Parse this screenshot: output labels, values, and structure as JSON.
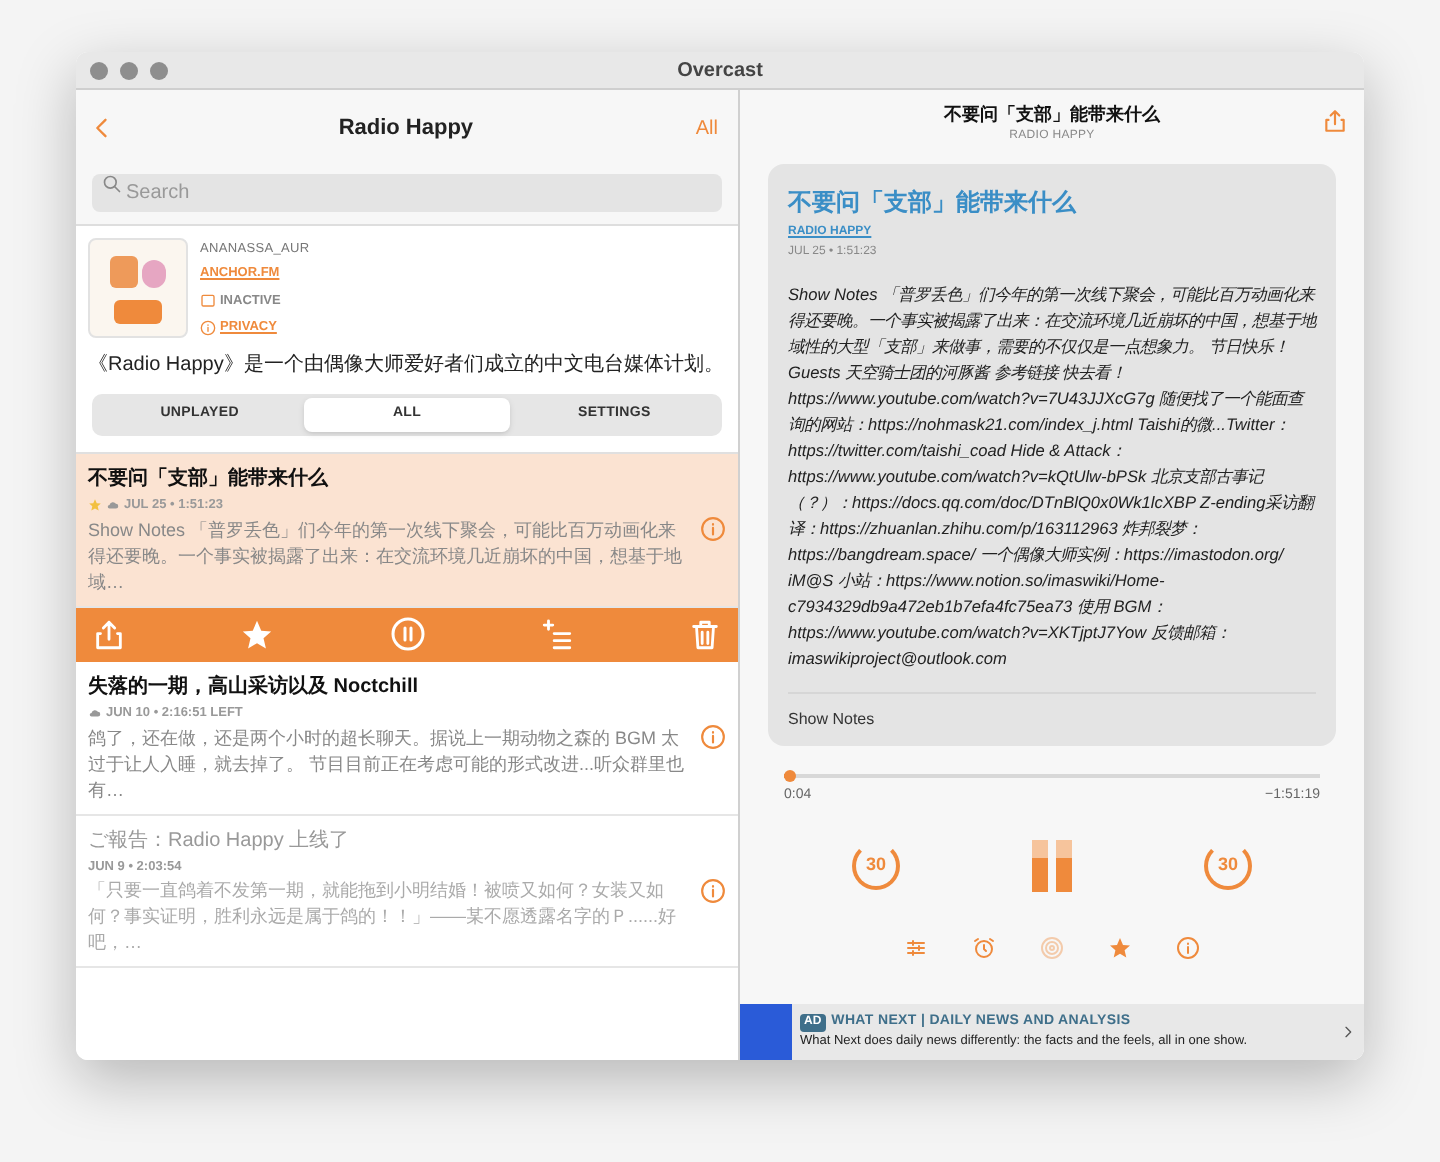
{
  "window": {
    "title": "Overcast"
  },
  "list_header": {
    "title": "Radio Happy",
    "filter": "All"
  },
  "search": {
    "placeholder": "Search"
  },
  "podcast": {
    "author": "ANANASSA_AUR",
    "host": "ANCHOR.FM",
    "status": "INACTIVE",
    "privacy": "PRIVACY",
    "description": "《Radio Happy》是一个由偶像大师爱好者们成立的中文电台媒体计划。"
  },
  "segments": [
    {
      "label": "UNPLAYED",
      "selected": false
    },
    {
      "label": "ALL",
      "selected": true
    },
    {
      "label": "SETTINGS",
      "selected": false
    }
  ],
  "episodes": [
    {
      "title": "不要问「支部」能带来什么",
      "meta": "JUL 25 • 1:51:23",
      "summary": "Show Notes 「普罗丢色」们今年的第一次线下聚会，可能比百万动画化来得还要晚。一个事实被揭露了出来：在交流环境几近崩坏的中国，想基于地域…",
      "selected": true,
      "played": false,
      "starred": true,
      "downloaded": true
    },
    {
      "title": "失落的一期，高山采访以及 Noctchill",
      "meta": "JUN 10 • 2:16:51 LEFT",
      "summary": "鸽了，还在做，还是两个小时的超长聊天。据说上一期动物之森的 BGM 太过于让人入睡，就去掉了。 节目目前正在考虑可能的形式改进...听众群里也有…",
      "selected": false,
      "played": false,
      "starred": false,
      "downloaded": true
    },
    {
      "title": "ご報告：Radio Happy 上线了",
      "meta": "JUN 9 • 2:03:54",
      "summary": "「只要一直鸽着不发第一期，就能拖到小明结婚！被喷又如何？女装又如何？事实证明，胜利永远是属于鸽的！！」——某不愿透露名字的Ｐ......好吧，…",
      "selected": false,
      "played": true,
      "starred": false,
      "downloaded": false
    }
  ],
  "now_playing": {
    "title": "不要问「支部」能带来什么",
    "podcast": "RADIO HAPPY"
  },
  "card": {
    "title": "不要问「支部」能带来什么",
    "podcast": "RADIO HAPPY",
    "date": "JUL 25 • 1:51:23",
    "notes": "Show Notes 「普罗丢色」们今年的第一次线下聚会，可能比百万动画化来得还要晚。一个事实被揭露了出来：在交流环境几近崩坏的中国，想基于地域性的大型「支部」来做事，需要的不仅仅是一点想象力。 节日快乐！ Guests 天空骑士团的河豚酱 参考链接 快去看！https://www.youtube.com/watch?v=7U43JJXcG7g 随便找了一个能面查询的网站：https://nohmask21.com/index_j.html Taishi的微...Twitter：https://twitter.com/taishi_coad Hide & Attack：https://www.youtube.com/watch?v=kQtUlw-bPSk 北京支部古事记（？）：https://docs.qq.com/doc/DTnBlQ0x0Wk1lcXBP Z-ending采访翻译：https://zhuanlan.zhihu.com/p/163112963 炸邦裂梦：https://bangdream.space/ 一个偶像大师实例：https://imastodon.org/ iM@S 小站：https://www.notion.so/imaswiki/Home-c7934329db9a472eb1b7efa4fc75ea73 使用 BGM：https://www.youtube.com/watch?v=XKTjptJ7Yow 反馈邮箱：imaswikiproject@outlook.com",
    "footer": "Show Notes"
  },
  "playback": {
    "level": 0.01,
    "elapsed": "0:04",
    "remaining": "−1:51:19",
    "skip_back": "30",
    "skip_forward": "30",
    "playing": true,
    "starred": true
  },
  "ad": {
    "badge": "AD",
    "title": "WHAT NEXT | DAILY NEWS AND ANALYSIS",
    "text": "What Next does daily news differently: the facts and the feels, all in one show."
  }
}
